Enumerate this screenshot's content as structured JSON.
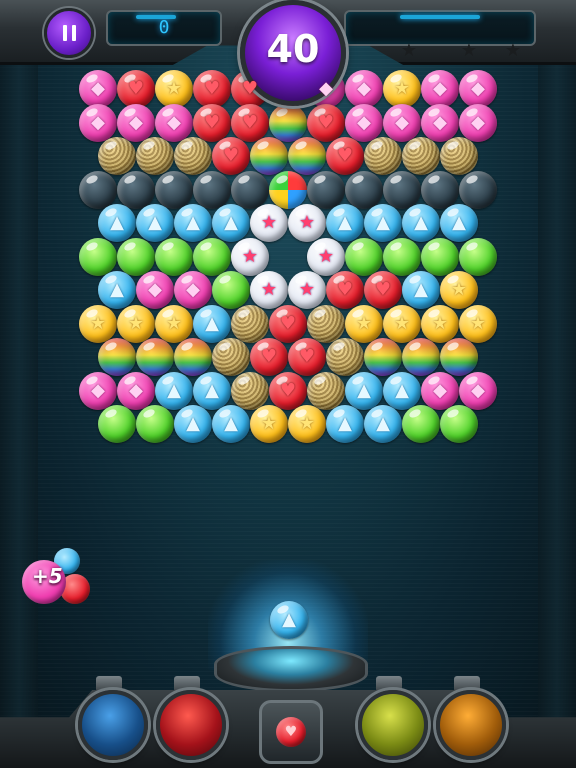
{
  "hud": {
    "score": "0",
    "moves_left": "40",
    "stars_earned": 0,
    "stars_total": 3
  },
  "bonus": {
    "label": "+5"
  },
  "colors": {
    "pink": "#ef3fb0",
    "red": "#e51d2b",
    "blue": "#35b4ef",
    "green": "#4fd12a",
    "yellow": "#ffbf19",
    "gold": "#c9a44a",
    "dark": "#2d3f4a",
    "purple_hud": "#7a1fd6"
  },
  "shooter": {
    "current_bubble": "blue-triangle",
    "next_bubble": "red-heart"
  },
  "boosters": [
    "blue",
    "red",
    "yellow",
    "orange"
  ],
  "bubble_rows": [
    [
      "pink",
      "red",
      "yellow",
      "red",
      "red",
      "gold",
      "pink",
      "pink",
      "yellow",
      "pink",
      "pink"
    ],
    [
      "pink",
      "pink",
      "pink",
      "red",
      "red",
      "rainbow",
      "red",
      "pink",
      "pink",
      "pink",
      "pink"
    ],
    [
      "gold",
      "gold",
      "gold",
      "red",
      "rainbow",
      "rainbow",
      "red",
      "gold",
      "gold",
      "gold"
    ],
    [
      "dark",
      "dark",
      "dark",
      "dark",
      "dark",
      "multi",
      "dark",
      "dark",
      "dark",
      "dark",
      "dark"
    ],
    [
      "blue",
      "blue",
      "blue",
      "blue",
      "star",
      "star",
      "blue",
      "blue",
      "blue",
      "blue"
    ],
    [
      "green",
      "green",
      "green",
      "green",
      "star",
      "",
      "star",
      "green",
      "green",
      "green",
      "green"
    ],
    [
      "blue",
      "pink",
      "pink",
      "green",
      "star",
      "star",
      "red",
      "red",
      "blue",
      "yellow"
    ],
    [
      "yellow",
      "yellow",
      "yellow",
      "blue",
      "gold",
      "red",
      "gold",
      "yellow",
      "yellow",
      "yellow",
      "yellow"
    ],
    [
      "rainbow",
      "rainbow",
      "rainbow",
      "gold",
      "red",
      "red",
      "gold",
      "rainbow",
      "rainbow",
      "rainbow"
    ],
    [
      "pink",
      "pink",
      "blue",
      "blue",
      "gold",
      "red",
      "gold",
      "blue",
      "blue",
      "pink",
      "pink"
    ],
    [
      "green",
      "green",
      "blue",
      "blue",
      "yellow",
      "yellow",
      "blue",
      "blue",
      "green",
      "green"
    ]
  ]
}
